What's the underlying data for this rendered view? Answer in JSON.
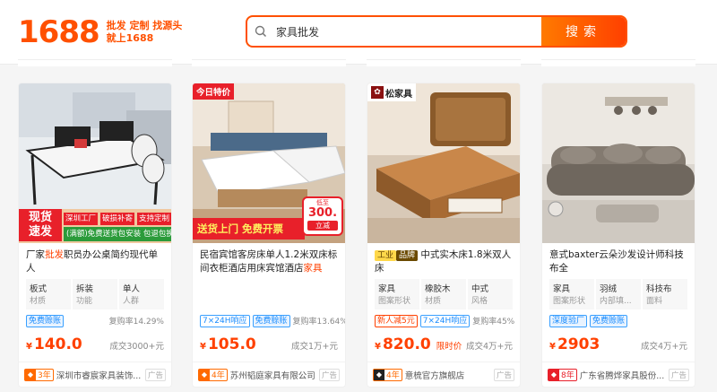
{
  "header": {
    "logo_num": "1688",
    "slogan_line1": "批发 定制 找源头",
    "slogan_line2": "就上1688",
    "search_value": "家具批发",
    "search_button": "搜索"
  },
  "cards": [
    {
      "badge_big1": "现货",
      "badge_big2": "速发",
      "banner1": "深圳工厂",
      "banner2": "破损补寄",
      "banner3": "支持定制",
      "banner4": "(满额)免费送货包安装 包退包换",
      "title_pre": "厂家",
      "title_hl": "批发",
      "title_post": "职员办公桌简约现代单人",
      "attrs": [
        {
          "v": "板式",
          "k": "材质"
        },
        {
          "v": "拆装",
          "k": "功能"
        },
        {
          "v": "单人",
          "k": "人群"
        }
      ],
      "tags": [
        "免费赊账"
      ],
      "metric": "复购率14.29%",
      "price_int": "140.0",
      "currency": "¥",
      "limited": "",
      "sold": "成交3000+元",
      "years": "3年",
      "shop": "深圳市睿宸家具装饰...",
      "ad": "广告"
    },
    {
      "corner": "今日特价",
      "banner_left": "送货上门 免费开票",
      "promo_pre": "低至",
      "promo_price": "300.",
      "promo_btn": "立减",
      "title_pre": "民宿宾馆客房床单人1.2米双床标间衣柜酒店用床宾馆酒店",
      "title_hl": "家具",
      "title_post": "",
      "attrs": [],
      "tags": [
        "7×24H响应",
        "免费赊账"
      ],
      "metric": "复购率13.64%",
      "price_int": "105.0",
      "currency": "¥",
      "limited": "",
      "sold": "成交1万+元",
      "years": "4年",
      "shop": "苏州韬庭家具有限公司",
      "ad": "广告"
    },
    {
      "brand": "松家具",
      "title_tags": [
        "工业",
        "品牌"
      ],
      "title_pre": "中式实木床1.8米双人床",
      "title_hl": "",
      "title_post": "",
      "attrs": [
        {
          "v": "家具",
          "k": "图案形状"
        },
        {
          "v": "橡胶木",
          "k": "材质"
        },
        {
          "v": "中式",
          "k": "风格"
        }
      ],
      "tags": [
        "新人减5元",
        "7×24H响应"
      ],
      "metric": "复购率45%",
      "price_int": "820.0",
      "currency": "¥",
      "limited": "限时价",
      "sold": "成交4万+元",
      "years": "4年",
      "shop": "意梳官方旗舰店",
      "ad": "广告"
    },
    {
      "title_pre": "意式baxter云朵沙发设计师科技布全",
      "title_hl": "",
      "title_post": "",
      "attrs": [
        {
          "v": "家具",
          "k": "图案形状"
        },
        {
          "v": "羽绒",
          "k": "内部填..."
        },
        {
          "v": "科技布",
          "k": "面料"
        }
      ],
      "tags": [
        "深度验厂",
        "免费赊账"
      ],
      "metric": "",
      "price_int": "2903",
      "currency": "¥",
      "limited": "",
      "sold": "成交4万+元",
      "years": "8年",
      "shop": "广东省腾烨家具股份...",
      "ad": "广告"
    }
  ],
  "colors": {
    "accent": "#ff5000",
    "price": "#ff4000",
    "link_blue": "#1a8cff"
  },
  "icons": [
    "search-icon",
    "shop-years-icon"
  ]
}
